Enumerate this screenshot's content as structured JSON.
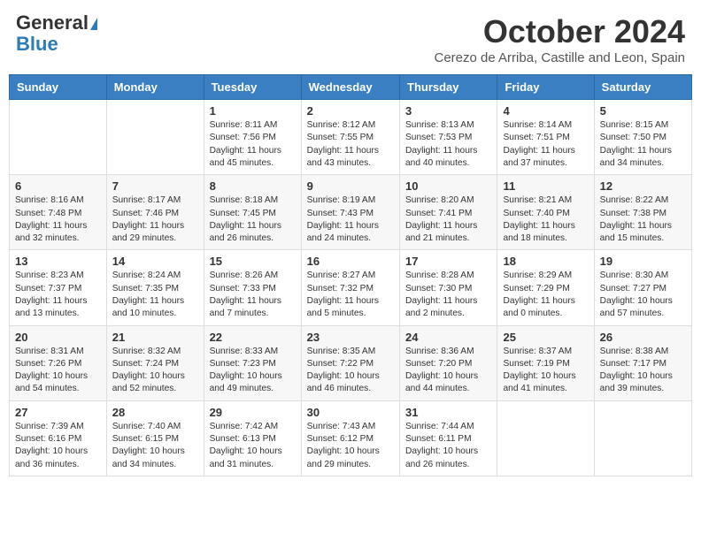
{
  "logo": {
    "general": "General",
    "blue": "Blue"
  },
  "header": {
    "month": "October 2024",
    "location": "Cerezo de Arriba, Castille and Leon, Spain"
  },
  "weekdays": [
    "Sunday",
    "Monday",
    "Tuesday",
    "Wednesday",
    "Thursday",
    "Friday",
    "Saturday"
  ],
  "weeks": [
    [
      {
        "day": "",
        "sunrise": "",
        "sunset": "",
        "daylight": ""
      },
      {
        "day": "",
        "sunrise": "",
        "sunset": "",
        "daylight": ""
      },
      {
        "day": "1",
        "sunrise": "Sunrise: 8:11 AM",
        "sunset": "Sunset: 7:56 PM",
        "daylight": "Daylight: 11 hours and 45 minutes."
      },
      {
        "day": "2",
        "sunrise": "Sunrise: 8:12 AM",
        "sunset": "Sunset: 7:55 PM",
        "daylight": "Daylight: 11 hours and 43 minutes."
      },
      {
        "day": "3",
        "sunrise": "Sunrise: 8:13 AM",
        "sunset": "Sunset: 7:53 PM",
        "daylight": "Daylight: 11 hours and 40 minutes."
      },
      {
        "day": "4",
        "sunrise": "Sunrise: 8:14 AM",
        "sunset": "Sunset: 7:51 PM",
        "daylight": "Daylight: 11 hours and 37 minutes."
      },
      {
        "day": "5",
        "sunrise": "Sunrise: 8:15 AM",
        "sunset": "Sunset: 7:50 PM",
        "daylight": "Daylight: 11 hours and 34 minutes."
      }
    ],
    [
      {
        "day": "6",
        "sunrise": "Sunrise: 8:16 AM",
        "sunset": "Sunset: 7:48 PM",
        "daylight": "Daylight: 11 hours and 32 minutes."
      },
      {
        "day": "7",
        "sunrise": "Sunrise: 8:17 AM",
        "sunset": "Sunset: 7:46 PM",
        "daylight": "Daylight: 11 hours and 29 minutes."
      },
      {
        "day": "8",
        "sunrise": "Sunrise: 8:18 AM",
        "sunset": "Sunset: 7:45 PM",
        "daylight": "Daylight: 11 hours and 26 minutes."
      },
      {
        "day": "9",
        "sunrise": "Sunrise: 8:19 AM",
        "sunset": "Sunset: 7:43 PM",
        "daylight": "Daylight: 11 hours and 24 minutes."
      },
      {
        "day": "10",
        "sunrise": "Sunrise: 8:20 AM",
        "sunset": "Sunset: 7:41 PM",
        "daylight": "Daylight: 11 hours and 21 minutes."
      },
      {
        "day": "11",
        "sunrise": "Sunrise: 8:21 AM",
        "sunset": "Sunset: 7:40 PM",
        "daylight": "Daylight: 11 hours and 18 minutes."
      },
      {
        "day": "12",
        "sunrise": "Sunrise: 8:22 AM",
        "sunset": "Sunset: 7:38 PM",
        "daylight": "Daylight: 11 hours and 15 minutes."
      }
    ],
    [
      {
        "day": "13",
        "sunrise": "Sunrise: 8:23 AM",
        "sunset": "Sunset: 7:37 PM",
        "daylight": "Daylight: 11 hours and 13 minutes."
      },
      {
        "day": "14",
        "sunrise": "Sunrise: 8:24 AM",
        "sunset": "Sunset: 7:35 PM",
        "daylight": "Daylight: 11 hours and 10 minutes."
      },
      {
        "day": "15",
        "sunrise": "Sunrise: 8:26 AM",
        "sunset": "Sunset: 7:33 PM",
        "daylight": "Daylight: 11 hours and 7 minutes."
      },
      {
        "day": "16",
        "sunrise": "Sunrise: 8:27 AM",
        "sunset": "Sunset: 7:32 PM",
        "daylight": "Daylight: 11 hours and 5 minutes."
      },
      {
        "day": "17",
        "sunrise": "Sunrise: 8:28 AM",
        "sunset": "Sunset: 7:30 PM",
        "daylight": "Daylight: 11 hours and 2 minutes."
      },
      {
        "day": "18",
        "sunrise": "Sunrise: 8:29 AM",
        "sunset": "Sunset: 7:29 PM",
        "daylight": "Daylight: 11 hours and 0 minutes."
      },
      {
        "day": "19",
        "sunrise": "Sunrise: 8:30 AM",
        "sunset": "Sunset: 7:27 PM",
        "daylight": "Daylight: 10 hours and 57 minutes."
      }
    ],
    [
      {
        "day": "20",
        "sunrise": "Sunrise: 8:31 AM",
        "sunset": "Sunset: 7:26 PM",
        "daylight": "Daylight: 10 hours and 54 minutes."
      },
      {
        "day": "21",
        "sunrise": "Sunrise: 8:32 AM",
        "sunset": "Sunset: 7:24 PM",
        "daylight": "Daylight: 10 hours and 52 minutes."
      },
      {
        "day": "22",
        "sunrise": "Sunrise: 8:33 AM",
        "sunset": "Sunset: 7:23 PM",
        "daylight": "Daylight: 10 hours and 49 minutes."
      },
      {
        "day": "23",
        "sunrise": "Sunrise: 8:35 AM",
        "sunset": "Sunset: 7:22 PM",
        "daylight": "Daylight: 10 hours and 46 minutes."
      },
      {
        "day": "24",
        "sunrise": "Sunrise: 8:36 AM",
        "sunset": "Sunset: 7:20 PM",
        "daylight": "Daylight: 10 hours and 44 minutes."
      },
      {
        "day": "25",
        "sunrise": "Sunrise: 8:37 AM",
        "sunset": "Sunset: 7:19 PM",
        "daylight": "Daylight: 10 hours and 41 minutes."
      },
      {
        "day": "26",
        "sunrise": "Sunrise: 8:38 AM",
        "sunset": "Sunset: 7:17 PM",
        "daylight": "Daylight: 10 hours and 39 minutes."
      }
    ],
    [
      {
        "day": "27",
        "sunrise": "Sunrise: 7:39 AM",
        "sunset": "Sunset: 6:16 PM",
        "daylight": "Daylight: 10 hours and 36 minutes."
      },
      {
        "day": "28",
        "sunrise": "Sunrise: 7:40 AM",
        "sunset": "Sunset: 6:15 PM",
        "daylight": "Daylight: 10 hours and 34 minutes."
      },
      {
        "day": "29",
        "sunrise": "Sunrise: 7:42 AM",
        "sunset": "Sunset: 6:13 PM",
        "daylight": "Daylight: 10 hours and 31 minutes."
      },
      {
        "day": "30",
        "sunrise": "Sunrise: 7:43 AM",
        "sunset": "Sunset: 6:12 PM",
        "daylight": "Daylight: 10 hours and 29 minutes."
      },
      {
        "day": "31",
        "sunrise": "Sunrise: 7:44 AM",
        "sunset": "Sunset: 6:11 PM",
        "daylight": "Daylight: 10 hours and 26 minutes."
      },
      {
        "day": "",
        "sunrise": "",
        "sunset": "",
        "daylight": ""
      },
      {
        "day": "",
        "sunrise": "",
        "sunset": "",
        "daylight": ""
      }
    ]
  ]
}
